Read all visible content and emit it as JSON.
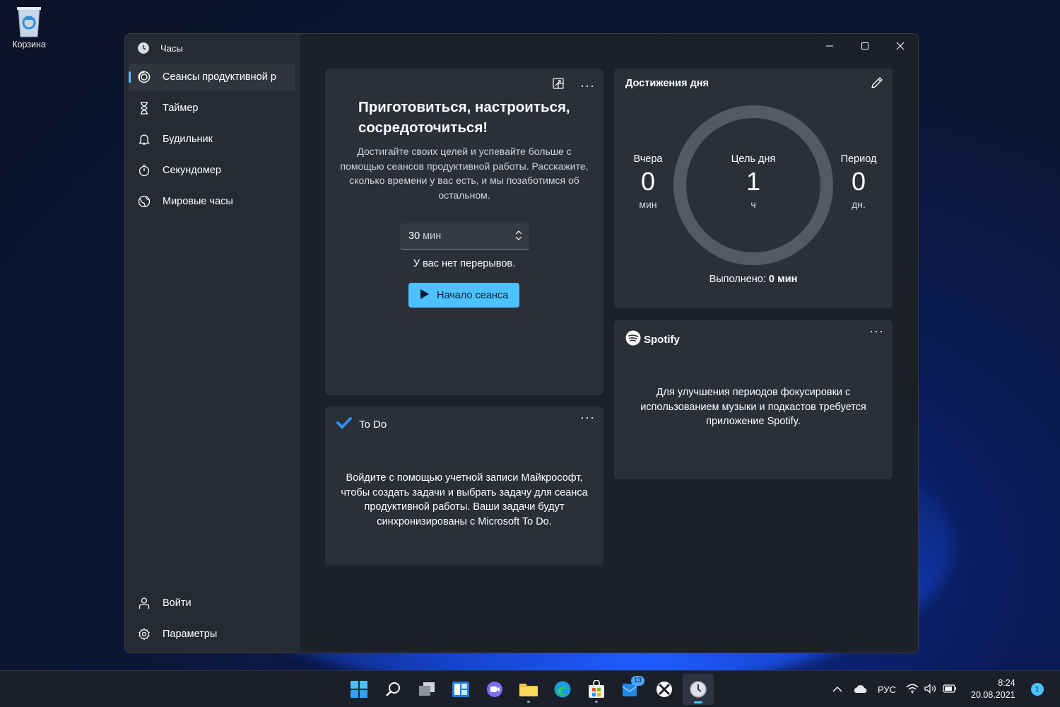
{
  "desktop": {
    "recycle_bin_label": "Корзина"
  },
  "window": {
    "app_title": "Часы",
    "nav": [
      {
        "label": "Сеансы продуктивной р",
        "icon": "focus-icon",
        "active": true
      },
      {
        "label": "Таймер",
        "icon": "hourglass-icon"
      },
      {
        "label": "Будильник",
        "icon": "bell-icon"
      },
      {
        "label": "Секундомер",
        "icon": "stopwatch-icon"
      },
      {
        "label": "Мировые часы",
        "icon": "globe-icon"
      }
    ],
    "nav_bottom": [
      {
        "label": "Войти",
        "icon": "person-icon"
      },
      {
        "label": "Параметры",
        "icon": "gear-icon"
      }
    ]
  },
  "focus": {
    "title": "Приготовиться, настроиться, сосредоточиться!",
    "description": "Достигайте своих целей и успевайте больше с помощью сеансов продуктивной работы. Расскажите, сколько времени у вас есть, и мы позаботимся об остальном.",
    "duration_value": "30",
    "duration_unit": "мин",
    "breaks_text": "У вас нет перерывов.",
    "start_button": "Начало сеанса"
  },
  "todo": {
    "title": "To Do",
    "body": "Войдите с помощью учетной записи Майкрософт, чтобы создать задачи и выбрать задачу для сеанса продуктивной работы. Ваши задачи будут синхронизированы с Microsoft To Do."
  },
  "achievements": {
    "title": "Достижения дня",
    "yesterday_label": "Вчера",
    "yesterday_value": "0",
    "yesterday_unit": "мин",
    "goal_label": "Цель дня",
    "goal_value": "1",
    "goal_unit": "ч",
    "period_label": "Период",
    "period_value": "0",
    "period_unit": "дн.",
    "done_label": "Выполнено:",
    "done_value": "0 мин"
  },
  "spotify": {
    "title": "Spotify",
    "body": "Для улучшения периодов фокусировки с использованием музыки и подкастов требуется приложение Spotify."
  },
  "taskbar": {
    "store_badge": "13",
    "language": "РУС",
    "time": "8:24",
    "date": "20.08.2021",
    "notifications": "1"
  },
  "colors": {
    "accent": "#4cc2ff",
    "card": "#2b2f38",
    "sidebar": "#262a33"
  }
}
